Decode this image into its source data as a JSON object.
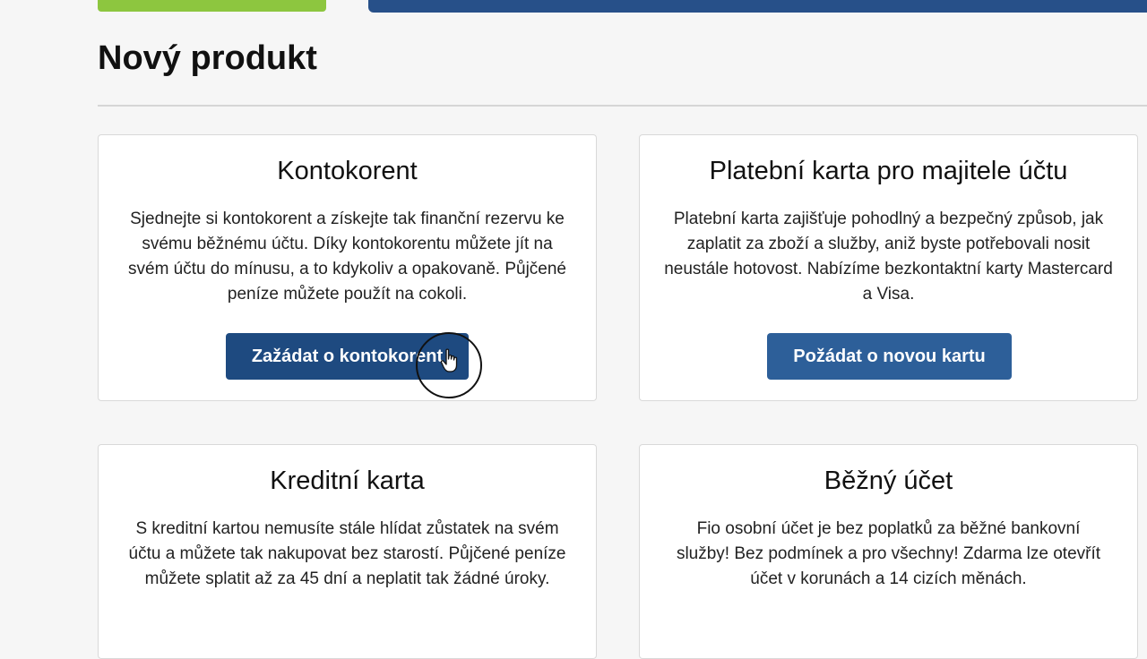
{
  "page": {
    "title": "Nový produkt"
  },
  "cards": [
    {
      "title": "Kontokorent",
      "description": "Sjednejte si kontokorent a získejte tak finanční rezervu ke svému běžnému účtu. Díky kontokorentu můžete jít na svém účtu do mínusu, a to kdykoliv a opakovaně. Půjčené peníze můžete použít na cokoli.",
      "button_label": "Zažádat o kontokorent"
    },
    {
      "title": "Platební karta pro majitele účtu",
      "description": "Platební karta zajišťuje pohodlný a bezpečný způsob, jak zaplatit za zboží a služby, aniž byste potřebovali nosit neustále hotovost. Nabízíme bezkontaktní karty Mastercard a Visa.",
      "button_label": "Požádat o novou kartu"
    },
    {
      "title": "Kreditní karta",
      "description": "S kreditní kartou nemusíte stále hlídat zůstatek na svém účtu a můžete tak nakupovat bez starostí. Půjčené peníze můžete splatit až za 45 dní a neplatit tak žádné úroky."
    },
    {
      "title": "Běžný účet",
      "description": "Fio osobní účet je bez poplatků za běžné bankovní služby! Bez podmínek a pro všechny! Zdarma lze otevřít účet v korunách a 14 cizích měnách."
    }
  ],
  "colors": {
    "accent_green": "#8dc63f",
    "header_blue": "#275089",
    "button_blue": "#2d5f99"
  }
}
